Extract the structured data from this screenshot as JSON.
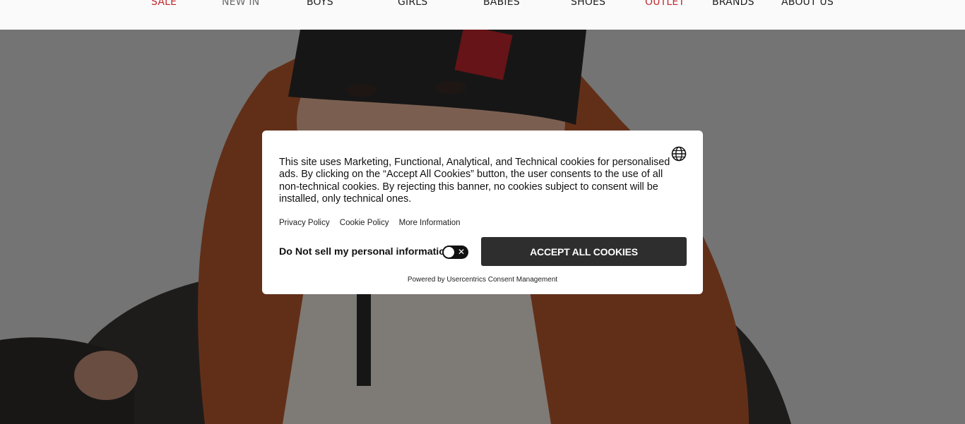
{
  "nav": {
    "items": [
      {
        "label": "SALE"
      },
      {
        "label": "NEW IN"
      },
      {
        "label": "BOYS"
      },
      {
        "label": "GIRLS"
      },
      {
        "label": "BABIES"
      },
      {
        "label": "SHOES"
      },
      {
        "label": "OUTLET"
      },
      {
        "label": "BRANDS"
      },
      {
        "label": "ABOUT US"
      }
    ]
  },
  "consent": {
    "message": "This site uses Marketing, Functional, Analytical, and Technical cookies for personalised ads. By clicking on the “Accept All Cookies” button, the user consents to the use of all non-technical cookies. By rejecting this banner, no cookies subject to consent will be installed, only technical ones.",
    "links": [
      "Privacy Policy",
      "Cookie Policy",
      "More Information"
    ],
    "do_not_sell_label": "Do Not sell my personal information",
    "toggle_state": "off",
    "accept_label": "ACCEPT ALL COOKIES",
    "powered_by": "Powered by Usercentrics Consent Management"
  },
  "colors": {
    "accent_red": "#c0272d",
    "button_dark": "#2e2e2e",
    "overlay": "rgba(0,0,0,0.47)"
  },
  "icons": {
    "language": "globe-icon",
    "toggle_off": "close-icon"
  }
}
